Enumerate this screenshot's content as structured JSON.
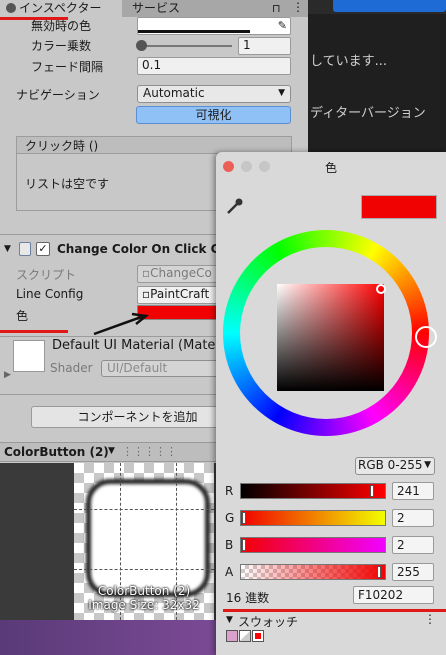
{
  "inspector": {
    "tab_inspector": "インスペクター",
    "tab_services": "サービス",
    "disabled_color_label": "無効時の色",
    "color_multiplier_label": "カラー乗数",
    "color_multiplier_value": "1",
    "fade_duration_label": "フェード間隔",
    "fade_duration_value": "0.1",
    "navigation_label": "ナビゲーション",
    "navigation_value": "Automatic",
    "visualize_button": "可視化",
    "onclick_header": "クリック時 ()",
    "list_empty": "リストは空です",
    "component_title": "Change Color On Click C",
    "script_label": "スクリプト",
    "script_value": "ChangeCo",
    "lineconfig_label": "Line Config",
    "lineconfig_value": "PaintCraft",
    "color_label": "色",
    "material_name": "Default UI Material (Mater",
    "shader_label": "Shader",
    "shader_value": "UI/Default",
    "add_component": "コンポーネントを追加",
    "preview_title": "ColorButton (2)",
    "preview_caption_name": "ColorButton (2)",
    "preview_caption_size": "Image Size: 32x32"
  },
  "background": {
    "text1": "しています...",
    "text2": "ディターバージョン"
  },
  "colorpicker": {
    "title": "色",
    "current_color": "#F10202",
    "mode_value": "RGB 0-255",
    "channels": [
      {
        "label": "R",
        "value": "241",
        "fraction": 0.945
      },
      {
        "label": "G",
        "value": "2",
        "fraction": 0.008
      },
      {
        "label": "B",
        "value": "2",
        "fraction": 0.008
      },
      {
        "label": "A",
        "value": "255",
        "fraction": 1.0
      }
    ],
    "hex_label": "16 進数",
    "hex_value": "F10202",
    "swatches_label": "スウォッチ"
  }
}
